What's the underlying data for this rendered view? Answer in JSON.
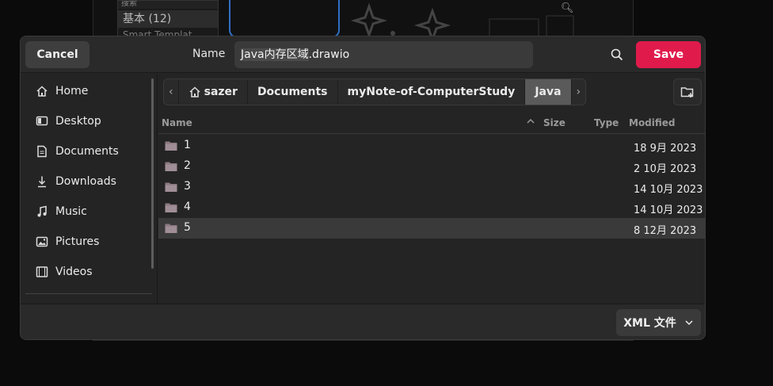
{
  "background": {
    "list_row1": "搜索",
    "list_row2": "基本 (12)",
    "list_row3": "Smart Templat"
  },
  "header": {
    "cancel_label": "Cancel",
    "name_label": "Name",
    "filename_selected": "Java内存区域",
    "filename_ext": ".drawio",
    "save_label": "Save"
  },
  "sidebar": {
    "items": [
      {
        "label": "Home",
        "icon": "home-icon"
      },
      {
        "label": "Desktop",
        "icon": "desktop-icon"
      },
      {
        "label": "Documents",
        "icon": "documents-icon"
      },
      {
        "label": "Downloads",
        "icon": "downloads-icon"
      },
      {
        "label": "Music",
        "icon": "music-icon"
      },
      {
        "label": "Pictures",
        "icon": "pictures-icon"
      },
      {
        "label": "Videos",
        "icon": "videos-icon"
      }
    ]
  },
  "pathbar": {
    "crumbs": [
      "sazer",
      "Documents",
      "myNote-of-ComputerStudy",
      "Java"
    ]
  },
  "list": {
    "columns": {
      "name": "Name",
      "size": "Size",
      "type": "Type",
      "modified": "Modified"
    },
    "rows": [
      {
        "name": "1",
        "modified": "18 9月 2023"
      },
      {
        "name": "2",
        "modified": "2 10月 2023"
      },
      {
        "name": "3",
        "modified": "14 10月 2023"
      },
      {
        "name": "4",
        "modified": "14 10月 2023"
      },
      {
        "name": "5",
        "modified": "8 12月 2023",
        "selected": true
      }
    ]
  },
  "footer": {
    "filter_label": "XML 文件"
  },
  "colors": {
    "accent_save": "#e01b4c",
    "folder": "#8a7880"
  }
}
